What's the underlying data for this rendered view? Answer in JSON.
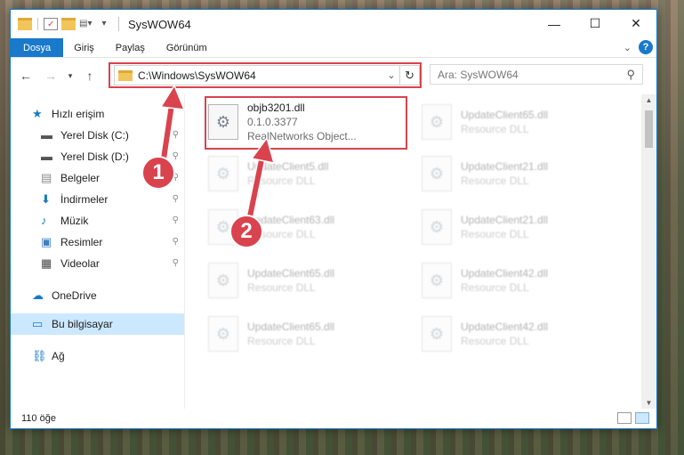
{
  "window": {
    "title": "SysWOW64",
    "controls": {
      "minimize": "—",
      "maximize": "☐",
      "close": "✕"
    }
  },
  "ribbon": {
    "tabs": [
      "Dosya",
      "Giriş",
      "Paylaş",
      "Görünüm"
    ],
    "help": "?"
  },
  "address_bar": {
    "path": "C:\\Windows\\SysWOW64",
    "refresh_icon": "↻"
  },
  "search": {
    "placeholder": "Ara: SysWOW64",
    "icon": "⚲"
  },
  "nav": {
    "items": [
      {
        "label": "Hızlı erişim",
        "icon": "star-icon",
        "color": "#1979ca",
        "level": 0,
        "pinned": false
      },
      {
        "label": "Yerel Disk (C:)",
        "icon": "drive-icon",
        "color": "#555555",
        "level": 1,
        "pinned": true
      },
      {
        "label": "Yerel Disk (D:)",
        "icon": "drive-icon",
        "color": "#555555",
        "level": 1,
        "pinned": true
      },
      {
        "label": "Belgeler",
        "icon": "documents-icon",
        "color": "#8a8a8a",
        "level": 1,
        "pinned": true
      },
      {
        "label": "İndirmeler",
        "icon": "download-icon",
        "color": "#1979ca",
        "level": 1,
        "pinned": true
      },
      {
        "label": "Müzik",
        "icon": "music-icon",
        "color": "#1979ca",
        "level": 1,
        "pinned": true
      },
      {
        "label": "Resimler",
        "icon": "pictures-icon",
        "color": "#3f7fbf",
        "level": 1,
        "pinned": true
      },
      {
        "label": "Videolar",
        "icon": "video-icon",
        "color": "#444444",
        "level": 1,
        "pinned": true
      }
    ],
    "onedrive": "OneDrive",
    "this_pc": "Bu bilgisayar",
    "network": "Ağ"
  },
  "files": [
    {
      "name": "objb3201.dll",
      "line2": "0.1.0.3377",
      "line3": "RealNetworks Object...",
      "focus": true
    },
    {
      "name": "UpdateClient65.dll",
      "line2": "Resource DLL",
      "focus": false
    },
    {
      "name": "UpdateClient5.dll",
      "line2": "Resource DLL",
      "focus": false
    },
    {
      "name": "UpdateClient21.dll",
      "line2": "Resource DLL",
      "focus": false
    },
    {
      "name": "UpdateClient63.dll",
      "line2": "Resource DLL",
      "focus": false
    },
    {
      "name": "UpdateClient21.dll",
      "line2": "Resource DLL",
      "focus": false
    },
    {
      "name": "UpdateClient65.dll",
      "line2": "Resource DLL",
      "focus": false
    },
    {
      "name": "UpdateClient42.dll",
      "line2": "Resource DLL",
      "focus": false
    },
    {
      "name": "UpdateClient65.dll",
      "line2": "Resource DLL",
      "focus": false
    },
    {
      "name": "UpdateClient42.dll",
      "line2": "Resource DLL",
      "focus": false
    }
  ],
  "status": {
    "count": "110 öğe"
  },
  "callouts": {
    "one": "1",
    "two": "2"
  },
  "colors": {
    "accent": "#1979ca",
    "highlight": "#d9434e",
    "selected": "#cce8ff"
  }
}
